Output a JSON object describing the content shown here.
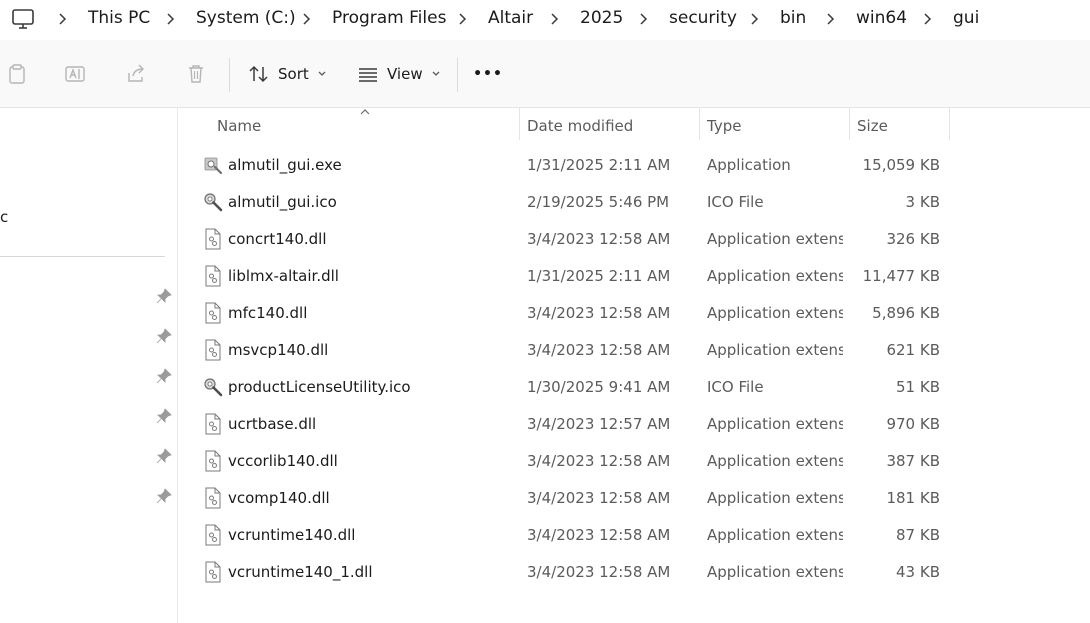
{
  "breadcrumb": {
    "items": [
      "This PC",
      "System (C:)",
      "Program Files",
      "Altair",
      "2025",
      "security",
      "bin",
      "win64",
      "gui"
    ]
  },
  "toolbar": {
    "sort_label": "Sort",
    "view_label": "View",
    "more_label": "•••"
  },
  "nav": {
    "partial_label": "c"
  },
  "columns": {
    "name": "Name",
    "date": "Date modified",
    "type": "Type",
    "size": "Size"
  },
  "files": [
    {
      "name": "almutil_gui.exe",
      "date": "1/31/2025 2:11 AM",
      "type": "Application",
      "size": "15,059 KB",
      "icon": "app-icon"
    },
    {
      "name": "almutil_gui.ico",
      "date": "2/19/2025 5:46 PM",
      "type": "ICO File",
      "size": "3 KB",
      "icon": "ico-icon"
    },
    {
      "name": "concrt140.dll",
      "date": "3/4/2023 12:58 AM",
      "type": "Application extens...",
      "size": "326 KB",
      "icon": "dll-icon"
    },
    {
      "name": "liblmx-altair.dll",
      "date": "1/31/2025 2:11 AM",
      "type": "Application extens...",
      "size": "11,477 KB",
      "icon": "dll-icon"
    },
    {
      "name": "mfc140.dll",
      "date": "3/4/2023 12:58 AM",
      "type": "Application extens...",
      "size": "5,896 KB",
      "icon": "dll-icon"
    },
    {
      "name": "msvcp140.dll",
      "date": "3/4/2023 12:58 AM",
      "type": "Application extens...",
      "size": "621 KB",
      "icon": "dll-icon"
    },
    {
      "name": "productLicenseUtility.ico",
      "date": "1/30/2025 9:41 AM",
      "type": "ICO File",
      "size": "51 KB",
      "icon": "ico-icon"
    },
    {
      "name": "ucrtbase.dll",
      "date": "3/4/2023 12:57 AM",
      "type": "Application extens...",
      "size": "970 KB",
      "icon": "dll-icon"
    },
    {
      "name": "vccorlib140.dll",
      "date": "3/4/2023 12:58 AM",
      "type": "Application extens...",
      "size": "387 KB",
      "icon": "dll-icon"
    },
    {
      "name": "vcomp140.dll",
      "date": "3/4/2023 12:58 AM",
      "type": "Application extens...",
      "size": "181 KB",
      "icon": "dll-icon"
    },
    {
      "name": "vcruntime140.dll",
      "date": "3/4/2023 12:58 AM",
      "type": "Application extens...",
      "size": "87 KB",
      "icon": "dll-icon"
    },
    {
      "name": "vcruntime140_1.dll",
      "date": "3/4/2023 12:58 AM",
      "type": "Application extens...",
      "size": "43 KB",
      "icon": "dll-icon"
    }
  ]
}
